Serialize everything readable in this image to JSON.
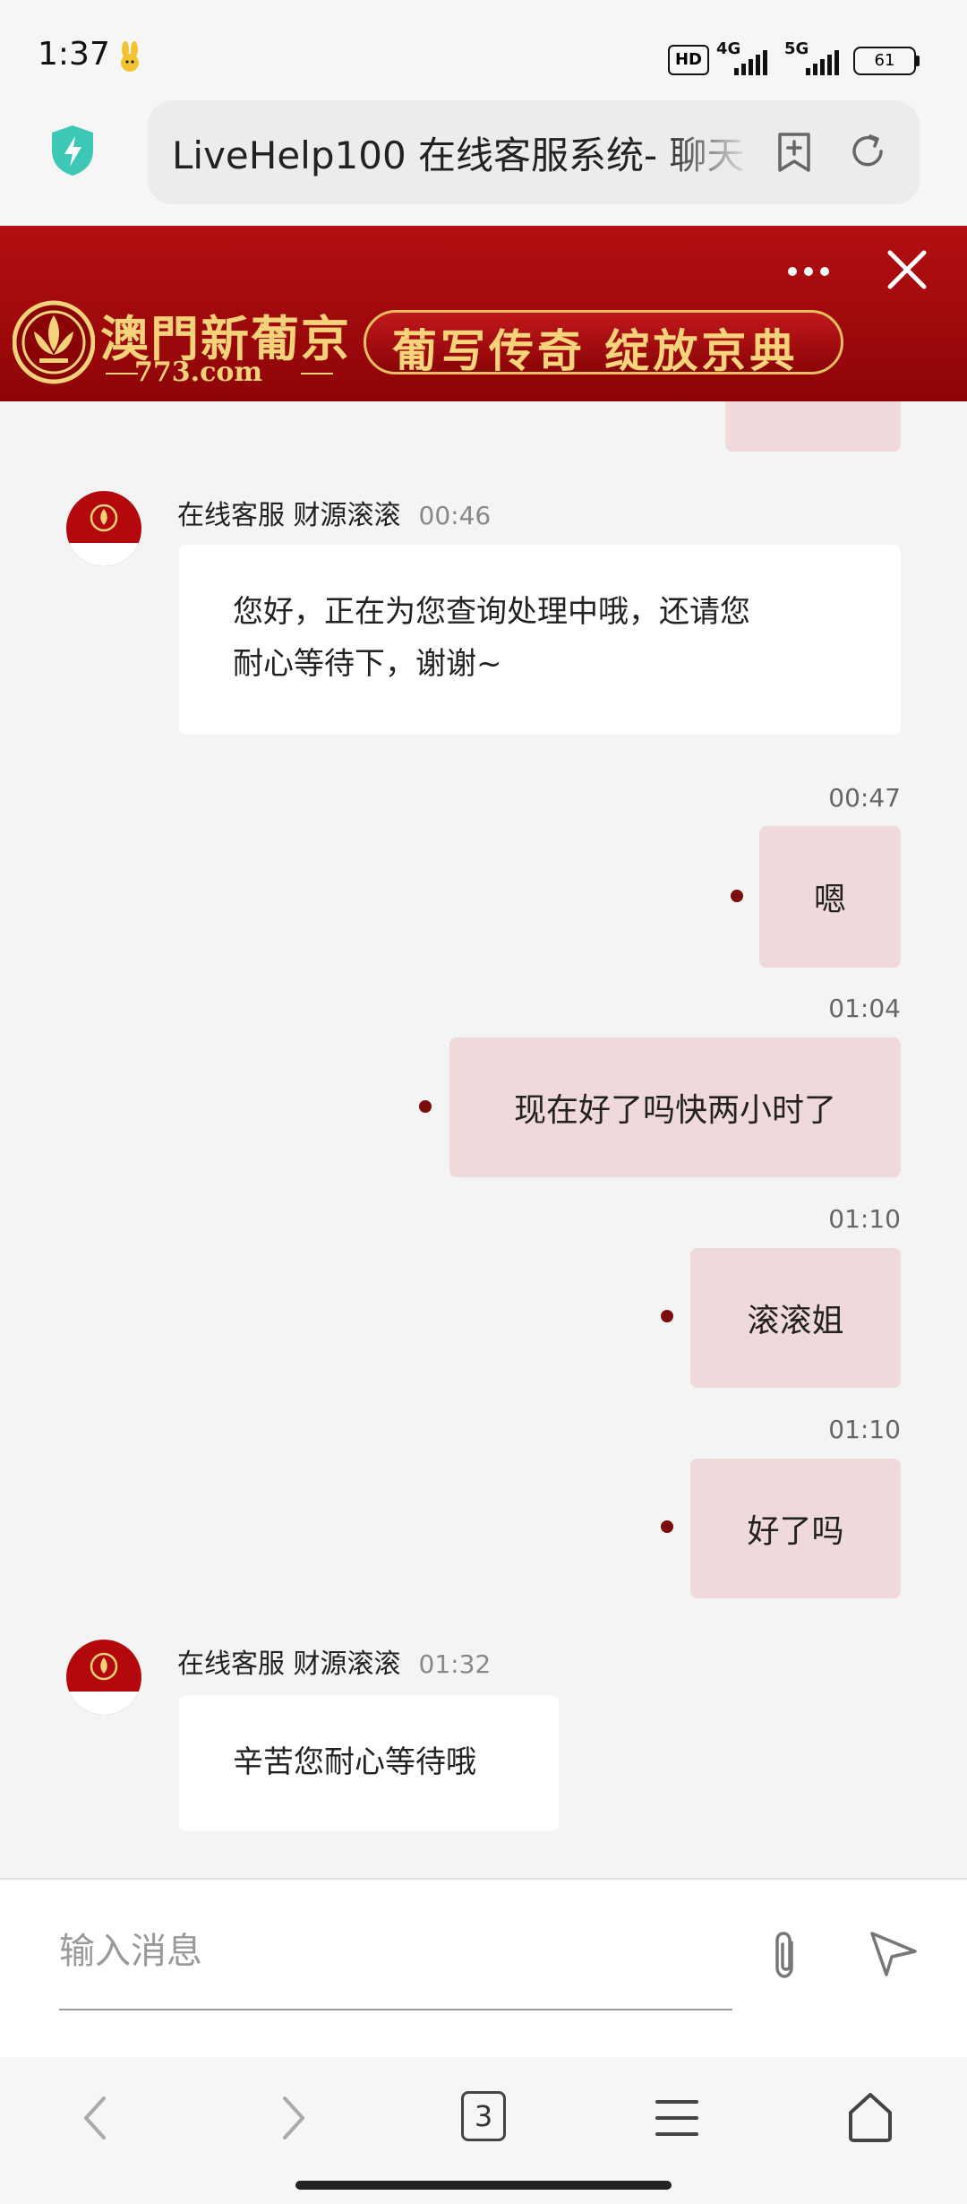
{
  "status_bar": {
    "time": "1:37",
    "hd_label": "HD",
    "signal_1": "4G",
    "signal_2": "5G",
    "battery": "61"
  },
  "browser": {
    "url_text": "LiveHelp100 在线客服系统- 聊天"
  },
  "banner": {
    "brand_name": "澳門新葡京",
    "brand_domain": "773.com",
    "slogan": "葡写传奇  绽放京典"
  },
  "chat": {
    "agent_name": "在线客服 财源滚滚",
    "avatar_text": "澳門新葡京",
    "messages": [
      {
        "sender": "agent",
        "time": "00:46",
        "text_line1": "您好，正在为您查询处理中哦，还请您",
        "text_line2": "耐心等待下，谢谢~"
      },
      {
        "sender": "user",
        "time": "00:47",
        "text": "嗯"
      },
      {
        "sender": "user",
        "time": "01:04",
        "text": "现在好了吗快两小时了"
      },
      {
        "sender": "user",
        "time": "01:10",
        "text": "滚滚姐"
      },
      {
        "sender": "user",
        "time": "01:10",
        "text": "好了吗"
      },
      {
        "sender": "agent",
        "time": "01:32",
        "text": "辛苦您耐心等待哦"
      }
    ]
  },
  "composer": {
    "placeholder": "输入消息"
  },
  "nav": {
    "tab_count": "3"
  },
  "colors": {
    "banner_red": "#a00a0d",
    "gold": "#f3d27a",
    "user_bubble": "#efd9da",
    "status_dot": "#7d0c0e"
  }
}
